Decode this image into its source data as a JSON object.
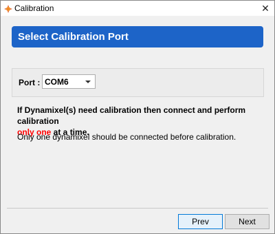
{
  "window": {
    "title": "Calibration",
    "close_glyph": "✕",
    "icon": "app-logo-icon"
  },
  "banner": {
    "title": "Select Calibration Port",
    "color": "#1d64c8"
  },
  "port": {
    "label": "Port :",
    "selected": "COM6"
  },
  "message": {
    "line_part1": "If Dynamixel(s) need calibration then connect and perform calibration",
    "highlight": "only one",
    "line_part2": " at a time.",
    "highlight_color": "#ff0000"
  },
  "info": "Only one dynamixel should be connected before calibration.",
  "buttons": {
    "prev": "Prev",
    "next": "Next"
  }
}
